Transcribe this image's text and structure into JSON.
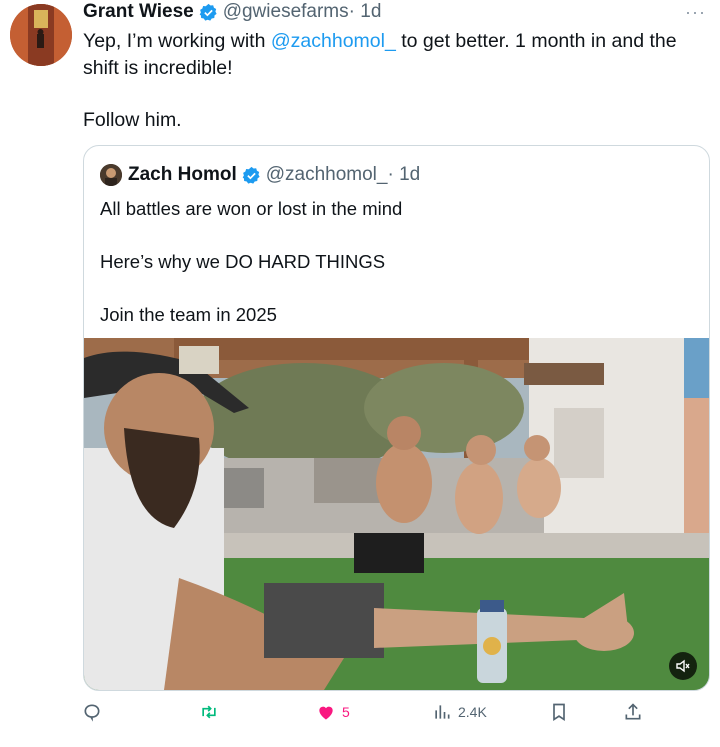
{
  "tweet": {
    "author_name": "Grant Wiese",
    "author_handle": "@gwiesefarms",
    "time": "· 1d",
    "more": "···",
    "text_before_mention": "Yep, I’m working with ",
    "mention": "@zachhomol_",
    "text_after_mention": "  to get better. 1 month in and the shift is incredible!",
    "text_second": "Follow him."
  },
  "quote": {
    "author_name": "Zach Homol",
    "author_handle": "@zachhomol_",
    "time": "· 1d",
    "lines": [
      "All battles are won or lost in the mind",
      "Here’s why we DO HARD THINGS",
      "Join the team in 2025"
    ],
    "media_description_icon": "mute-icon"
  },
  "actions": {
    "reply_count": "",
    "retweet_count": "",
    "like_count": "5",
    "views_count": "2.4K"
  },
  "colors": {
    "link": "#1d9bf0",
    "muted": "#536471",
    "like": "#f91880",
    "retweet": "#00ba7c",
    "verified": "#1d9bf0"
  }
}
